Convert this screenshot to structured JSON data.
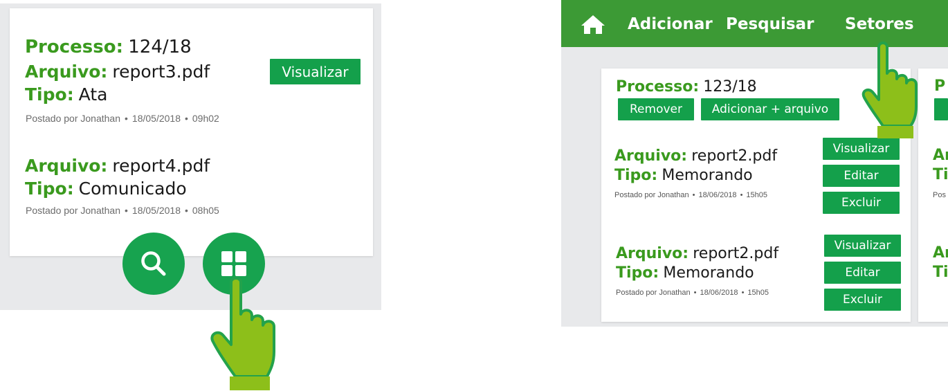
{
  "left": {
    "process": {
      "label": "Processo:",
      "number": "124/18"
    },
    "file1": {
      "file_label": "Arquivo:",
      "file_name": "report3.pdf",
      "type_label": "Tipo:",
      "type_value": "Ata",
      "posted": "Postado por Jonathan",
      "date": "18/05/2018",
      "time": "09h02",
      "view_button": "Visualizar"
    },
    "file2": {
      "file_label": "Arquivo:",
      "file_name": "report4.pdf",
      "type_label": "Tipo:",
      "type_value": "Comunicado",
      "posted": "Postado por Jonathan",
      "date": "18/05/2018",
      "time": "08h05"
    },
    "bottom_buttons": [
      {
        "icon": "search-icon"
      },
      {
        "icon": "grid-icon"
      }
    ]
  },
  "right": {
    "nav": {
      "home_icon": "home-icon",
      "items": [
        "Adicionar",
        "Pesquisar",
        "Setores"
      ]
    },
    "card": {
      "process_label": "Processo:",
      "process_number": "123/18",
      "remove_button": "Remover",
      "add_file_button": "Adicionar + arquivo",
      "files": [
        {
          "file_label": "Arquivo:",
          "file_name": "report2.pdf",
          "type_label": "Tipo:",
          "type_value": "Memorando",
          "posted": "Postado por Jonathan",
          "date": "18/06/2018",
          "time": "15h05",
          "view": "Visualizar",
          "edit": "Editar",
          "delete": "Excluir"
        },
        {
          "file_label": "Arquivo:",
          "file_name": "report2.pdf",
          "type_label": "Tipo:",
          "type_value": "Memorando",
          "posted": "Postado por Jonathan",
          "date": "18/06/2018",
          "time": "15h05",
          "view": "Visualizar",
          "edit": "Editar",
          "delete": "Excluir"
        }
      ]
    },
    "partial_card": {
      "process_fragment": "P",
      "file_fragment_1": "Ar",
      "type_fragment_1": "Ti",
      "file_fragment_2": "Ar",
      "type_fragment_2": "Ti",
      "meta_fragment": "Pos"
    }
  },
  "colors": {
    "label_green": "#3a9a1e",
    "button_green": "#14a04b",
    "topbar_green": "#3c9a35",
    "hand_green": "#8dbf1a",
    "panel_gray": "#e8e9eb"
  }
}
